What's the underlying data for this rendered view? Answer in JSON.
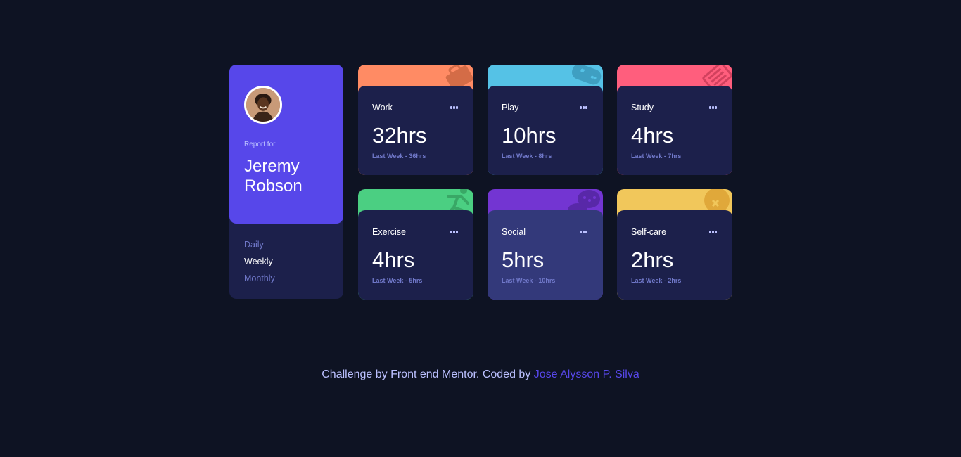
{
  "profile": {
    "report_for": "Report for",
    "name": "Jeremy Robson",
    "timeframes": [
      "Daily",
      "Weekly",
      "Monthly"
    ],
    "active_timeframe": "Weekly"
  },
  "cards": [
    {
      "title": "Work",
      "current": "32hrs",
      "previous": "Last Week - 36hrs",
      "color": "#ff8b64",
      "icon": "briefcase-icon"
    },
    {
      "title": "Play",
      "current": "10hrs",
      "previous": "Last Week - 8hrs",
      "color": "#55c2e6",
      "icon": "gamepad-icon"
    },
    {
      "title": "Study",
      "current": "4hrs",
      "previous": "Last Week - 7hrs",
      "color": "#ff5e7d",
      "icon": "book-icon"
    },
    {
      "title": "Exercise",
      "current": "4hrs",
      "previous": "Last Week - 5hrs",
      "color": "#4bcf82",
      "icon": "running-icon"
    },
    {
      "title": "Social",
      "current": "5hrs",
      "previous": "Last Week - 10hrs",
      "color": "#7335d2",
      "icon": "chat-icon"
    },
    {
      "title": "Self-care",
      "current": "2hrs",
      "previous": "Last Week - 2hrs",
      "color": "#f1c75b",
      "icon": "heart-icon"
    }
  ],
  "footer": {
    "prefix": "Challenge by Front end Mentor. Coded by ",
    "author": "Jose Alysson P. Silva"
  },
  "colors": {
    "page_bg": "#0e1323",
    "card_bg": "#1c204b",
    "card_hover_bg": "#33397a",
    "accent": "#5747ea",
    "muted_text": "#7078c9",
    "pale_text": "#bbc0ff"
  }
}
